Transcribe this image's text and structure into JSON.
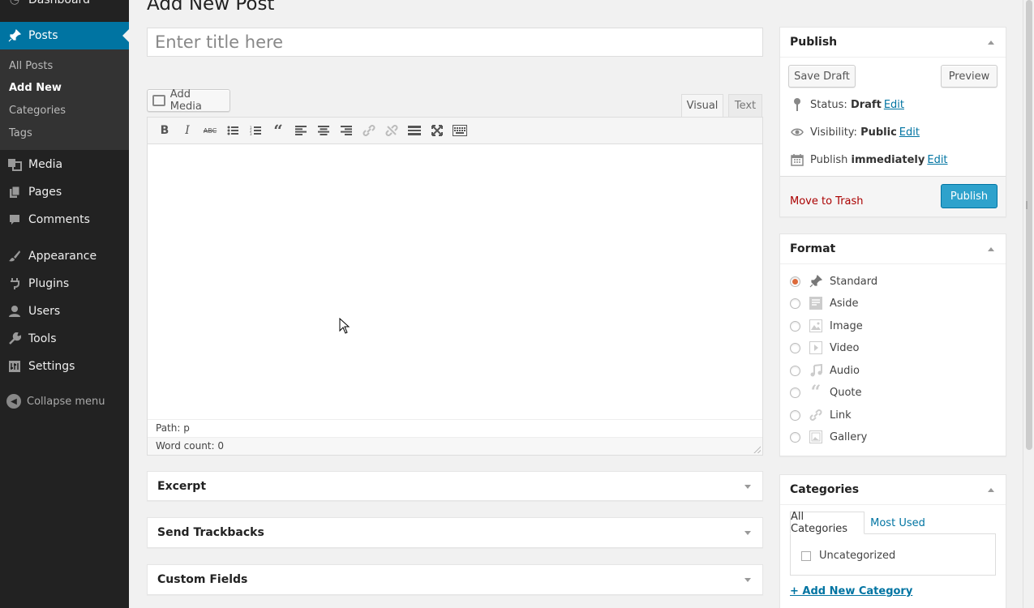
{
  "sidebar": {
    "dashboard": "Dashboard",
    "posts": "Posts",
    "sub": {
      "all_posts": "All Posts",
      "add_new": "Add New",
      "categories": "Categories",
      "tags": "Tags"
    },
    "media": "Media",
    "pages": "Pages",
    "comments": "Comments",
    "appearance": "Appearance",
    "plugins": "Plugins",
    "users": "Users",
    "tools": "Tools",
    "settings": "Settings",
    "collapse": "Collapse menu"
  },
  "page_title": "Add New Post",
  "title_placeholder": "Enter title here",
  "editor": {
    "add_media": "Add Media",
    "tab_visual": "Visual",
    "tab_text": "Text",
    "path": "Path: p",
    "word_count": "Word count: 0"
  },
  "boxes": {
    "excerpt": "Excerpt",
    "trackbacks": "Send Trackbacks",
    "custom_fields": "Custom Fields"
  },
  "publish": {
    "title": "Publish",
    "save_draft": "Save Draft",
    "preview": "Preview",
    "status_label": "Status:",
    "status_value": "Draft",
    "visibility_label": "Visibility:",
    "visibility_value": "Public",
    "publish_label": "Publish",
    "publish_value": "immediately",
    "edit": "Edit",
    "move_to_trash": "Move to Trash",
    "publish_button": "Publish"
  },
  "format": {
    "title": "Format",
    "options": [
      "Standard",
      "Aside",
      "Image",
      "Video",
      "Audio",
      "Quote",
      "Link",
      "Gallery"
    ],
    "selected": "Standard"
  },
  "categories": {
    "title": "Categories",
    "tab_all": "All Categories",
    "tab_most_used": "Most Used",
    "items": [
      "Uncategorized"
    ],
    "add_new": "+ Add New Category"
  },
  "colors": {
    "accent": "#0074a2",
    "publish_button": "#2ea2cc",
    "trash": "#aa0000",
    "sidebar": "#222222"
  }
}
